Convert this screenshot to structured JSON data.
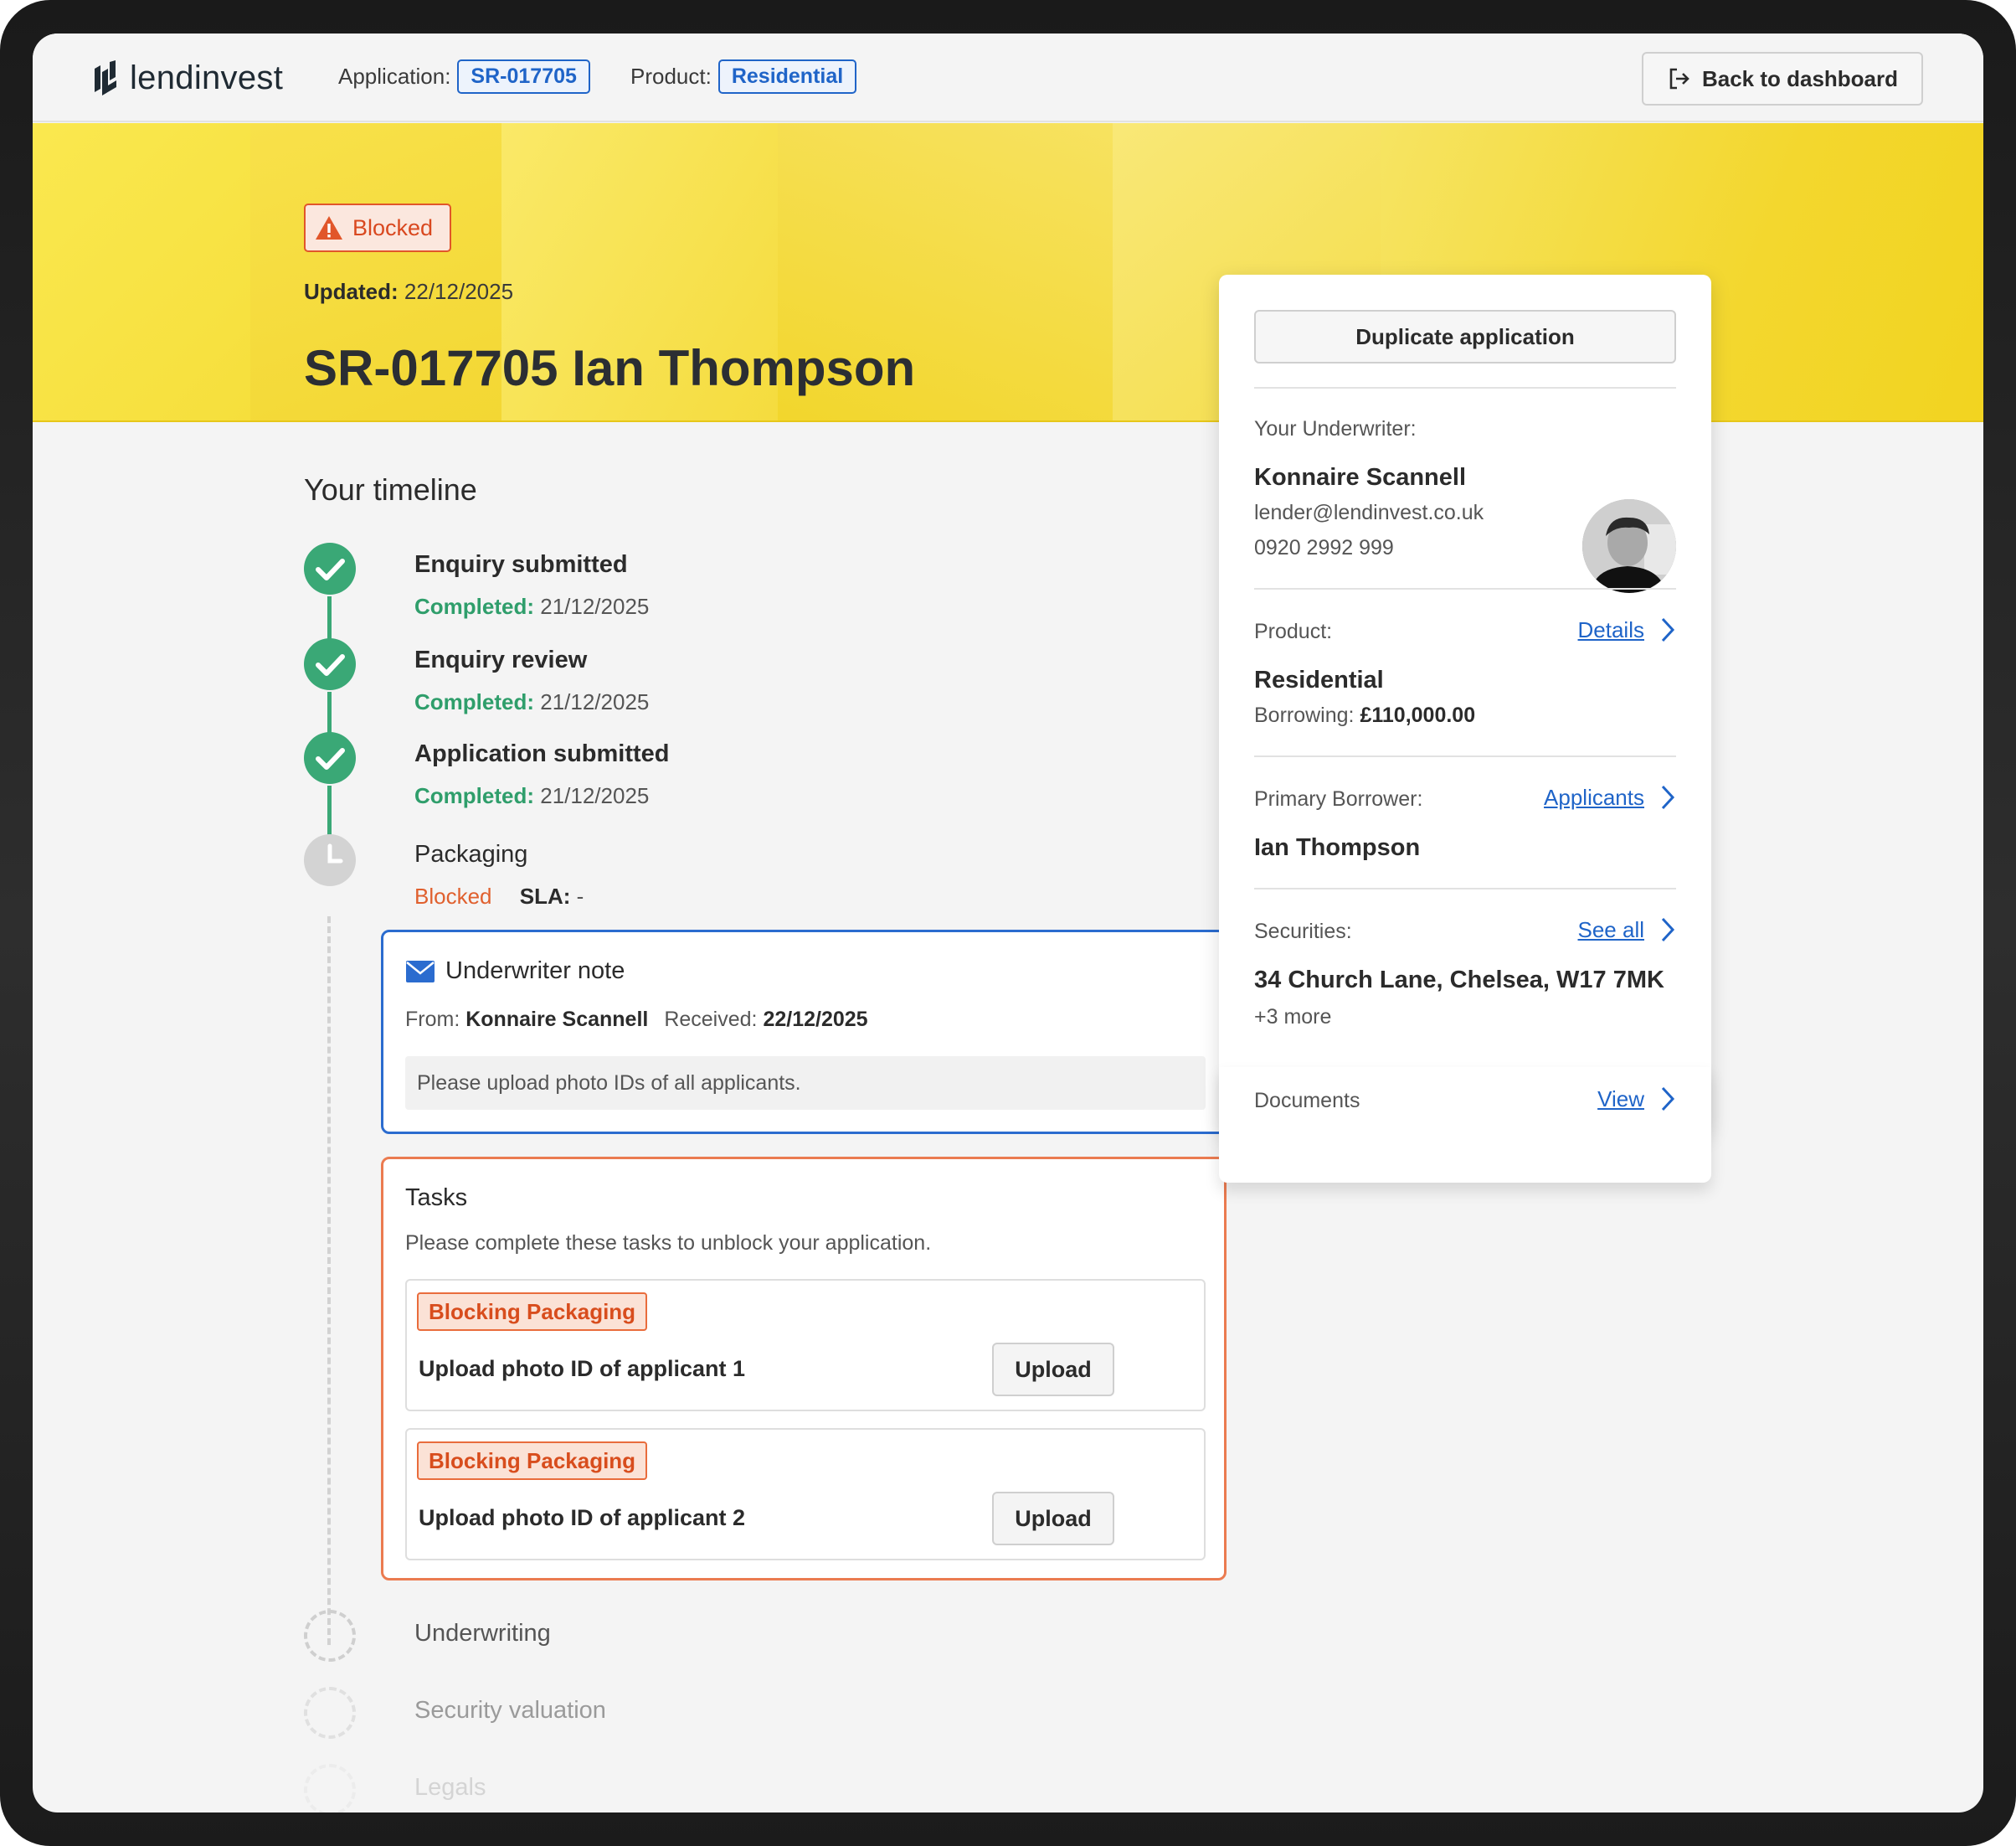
{
  "colors": {
    "accent_blue": "#1f64c8",
    "success_green": "#3aa876",
    "blocked_orange": "#e1562a",
    "hero_yellow": "#f4d82a",
    "background": "#f4f4f4"
  },
  "header": {
    "logo_text": "lendinvest",
    "application_label": "Application:",
    "application_id": "SR-017705",
    "product_label": "Product:",
    "product_value": "Residential",
    "back_button": "Back to dashboard",
    "back_icon": "exit-arrow-icon"
  },
  "hero": {
    "status_badge": "Blocked",
    "status_icon": "warning-triangle-icon",
    "updated_label": "Updated:",
    "updated_value": "22/12/2025",
    "title": "SR-017705 Ian Thompson"
  },
  "timeline": {
    "title": "Your timeline",
    "steps": [
      {
        "name": "Enquiry submitted",
        "status": "Completed:",
        "date": "21/12/2025",
        "state": "done"
      },
      {
        "name": "Enquiry review",
        "status": "Completed:",
        "date": "21/12/2025",
        "state": "done"
      },
      {
        "name": "Application submitted",
        "status": "Completed:",
        "date": "21/12/2025",
        "state": "done"
      },
      {
        "name": "Packaging",
        "status": "Blocked",
        "sla_label": "SLA:",
        "sla_value": "-",
        "state": "in-progress"
      },
      {
        "name": "Underwriting",
        "state": "pending"
      },
      {
        "name": "Security valuation",
        "state": "pending"
      },
      {
        "name": "Legals",
        "state": "pending"
      }
    ]
  },
  "note": {
    "icon": "envelope-icon",
    "title": "Underwriter note",
    "from_label": "From:",
    "from_value": "Konnaire Scannell",
    "received_label": "Received:",
    "received_value": "22/12/2025",
    "message": "Please upload photo IDs of all applicants."
  },
  "tasks": {
    "title": "Tasks",
    "subtitle": "Please complete these tasks to unblock your application.",
    "items": [
      {
        "badge": "Blocking Packaging",
        "name": "Upload photo ID of applicant 1",
        "button": "Upload"
      },
      {
        "badge": "Blocking Packaging",
        "name": "Upload photo ID of applicant 2",
        "button": "Upload"
      }
    ]
  },
  "panel": {
    "duplicate_button": "Duplicate application",
    "underwriter_label": "Your Underwriter:",
    "underwriter_name": "Konnaire Scannell",
    "underwriter_email": "lender@lendinvest.co.uk",
    "underwriter_phone": "0920 2992 999",
    "product_label": "Product:",
    "product_link": "Details",
    "product_value": "Residential",
    "borrowing_label": "Borrowing:",
    "borrowing_value": "£110,000.00",
    "borrower_label": "Primary Borrower:",
    "borrower_link": "Applicants",
    "borrower_value": "Ian Thompson",
    "securities_label": "Securities:",
    "securities_link": "See all",
    "securities_value": "34 Church Lane, Chelsea, W17 7MK",
    "securities_more": "+3 more",
    "documents_label": "Documents",
    "documents_link": "View"
  }
}
